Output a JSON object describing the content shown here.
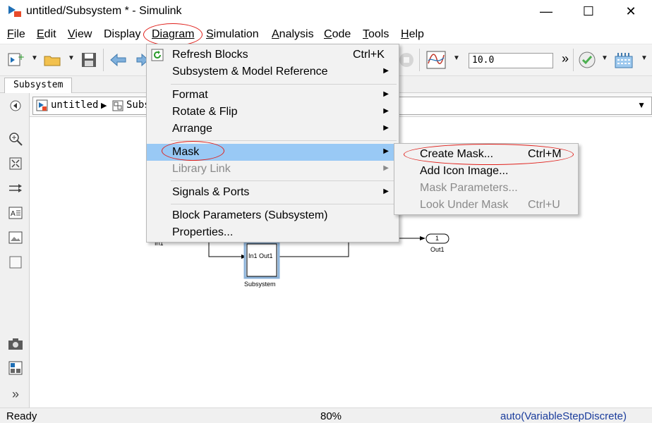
{
  "window": {
    "title": "untitled/Subsystem * - Simulink",
    "minimize": "—",
    "maximize": "☐",
    "close": "✕"
  },
  "menubar": [
    {
      "label": "File",
      "key": "F",
      "rest": "ile"
    },
    {
      "label": "Edit",
      "key": "E",
      "rest": "dit"
    },
    {
      "label": "View",
      "key": "V",
      "rest": "iew"
    },
    {
      "label": "Display",
      "key": "",
      "rest": "Display"
    },
    {
      "label": "Diagram",
      "key": "",
      "rest": "Diagram"
    },
    {
      "label": "Simulation",
      "key": "S",
      "rest": "imulation"
    },
    {
      "label": "Analysis",
      "key": "A",
      "rest": "nalysis"
    },
    {
      "label": "Code",
      "key": "C",
      "rest": "ode"
    },
    {
      "label": "Tools",
      "key": "T",
      "rest": "ools"
    },
    {
      "label": "Help",
      "key": "H",
      "rest": "elp"
    }
  ],
  "toolbar": {
    "stop_time": "10.0",
    "overflow": "»"
  },
  "tab": {
    "label": "Subsystem"
  },
  "breadcrumb": {
    "root": "untitled",
    "current": "Subs"
  },
  "diagram_menu": {
    "items": [
      {
        "label": "Refresh Blocks",
        "shortcut": "Ctrl+K"
      },
      {
        "label": "Subsystem & Model Reference"
      },
      {
        "label": "Format"
      },
      {
        "label": "Rotate & Flip"
      },
      {
        "label": "Arrange"
      },
      {
        "label": "Mask"
      },
      {
        "label": "Library Link"
      },
      {
        "label": "Signals & Ports"
      },
      {
        "label": "Block Parameters (Subsystem)"
      },
      {
        "label": "Properties..."
      }
    ]
  },
  "mask_submenu": {
    "items": [
      {
        "label": "Create Mask...",
        "shortcut": "Ctrl+M"
      },
      {
        "label": "Add Icon Image..."
      },
      {
        "label": "Mask Parameters..."
      },
      {
        "label": "Look Under Mask",
        "shortcut": "Ctrl+U"
      }
    ]
  },
  "model": {
    "block_ports": "In1 Out1",
    "block_name": "Subsystem",
    "out_port_number": "1",
    "out_port_name": "Out1",
    "in_partial": "In1"
  },
  "status": {
    "state": "Ready",
    "zoom": "80%",
    "solver": "auto(VariableStepDiscrete)"
  },
  "colors": {
    "highlight": "#99c9f5",
    "annotation": "#e0201b",
    "solver_text": "#1a3c9c"
  }
}
